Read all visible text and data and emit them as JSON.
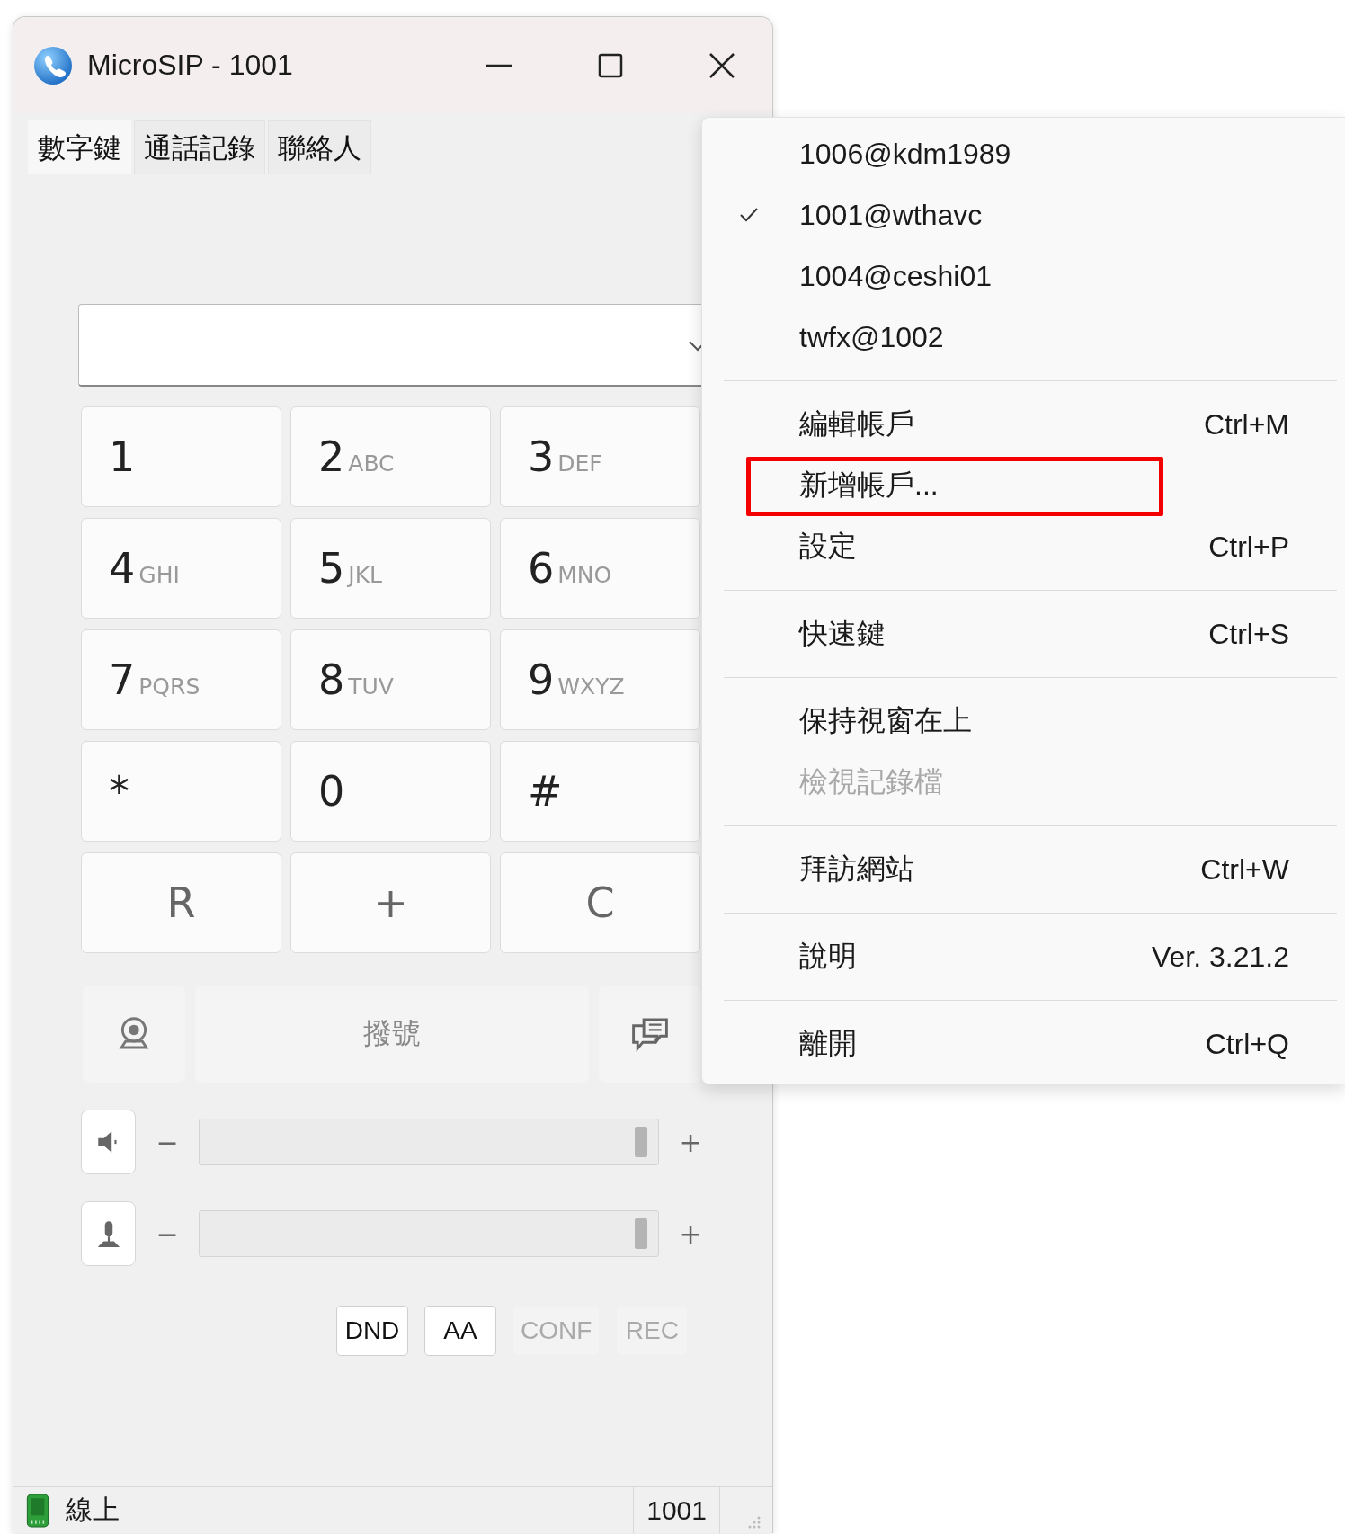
{
  "window": {
    "title": "MicroSIP - 1001"
  },
  "tabs": [
    {
      "label": "數字鍵",
      "selected": true
    },
    {
      "label": "通話記錄",
      "selected": false
    },
    {
      "label": "聯絡人",
      "selected": false
    }
  ],
  "keypad": [
    {
      "kind": "digit",
      "digit": "1"
    },
    {
      "kind": "digit",
      "digit": "2",
      "letters": "ABC"
    },
    {
      "kind": "digit",
      "digit": "3",
      "letters": "DEF"
    },
    {
      "kind": "digit",
      "digit": "4",
      "letters": "GHI"
    },
    {
      "kind": "digit",
      "digit": "5",
      "letters": "JKL"
    },
    {
      "kind": "digit",
      "digit": "6",
      "letters": "MNO"
    },
    {
      "kind": "digit",
      "digit": "7",
      "letters": "PQRS"
    },
    {
      "kind": "digit",
      "digit": "8",
      "letters": "TUV"
    },
    {
      "kind": "digit",
      "digit": "9",
      "letters": "WXYZ"
    },
    {
      "kind": "digit",
      "digit": "*"
    },
    {
      "kind": "digit",
      "digit": "0"
    },
    {
      "kind": "digit",
      "digit": "#"
    },
    {
      "kind": "action",
      "digit": "R"
    },
    {
      "kind": "action",
      "digit": "+"
    },
    {
      "kind": "action",
      "digit": "C"
    }
  ],
  "call_button": {
    "label": "撥號"
  },
  "volume": [
    {
      "kind": "speaker",
      "minus": "−",
      "plus": "+",
      "level": 0.98
    },
    {
      "kind": "microphone",
      "minus": "−",
      "plus": "+",
      "level": 0.98
    }
  ],
  "toggles": [
    {
      "label": "DND",
      "on": true
    },
    {
      "label": "AA",
      "on": true
    },
    {
      "label": "CONF",
      "on": false
    },
    {
      "label": "REC",
      "on": false
    }
  ],
  "status_bar": {
    "status": "線上",
    "account": "1001"
  },
  "menu": {
    "sections": [
      [
        {
          "label": "1006@kdm1989",
          "checked": false,
          "disabled": false,
          "highlighted": false
        },
        {
          "label": "1001@wthavc",
          "checked": true,
          "disabled": false,
          "highlighted": false
        },
        {
          "label": "1004@ceshi01",
          "checked": false,
          "disabled": false,
          "highlighted": false
        },
        {
          "label": "twfx@1002",
          "checked": false,
          "disabled": false,
          "highlighted": false
        }
      ],
      [
        {
          "label": "編輯帳戶",
          "shortcut": "Ctrl+M",
          "checked": false,
          "disabled": false,
          "highlighted": false
        },
        {
          "label": "新增帳戶...",
          "checked": false,
          "disabled": false,
          "highlighted": true
        },
        {
          "label": "設定",
          "shortcut": "Ctrl+P",
          "checked": false,
          "disabled": false,
          "highlighted": false
        }
      ],
      [
        {
          "label": "快速鍵",
          "shortcut": "Ctrl+S",
          "checked": false,
          "disabled": false,
          "highlighted": false
        }
      ],
      [
        {
          "label": "保持視窗在上",
          "checked": false,
          "disabled": false,
          "highlighted": false
        },
        {
          "label": "檢視記錄檔",
          "checked": false,
          "disabled": true,
          "highlighted": false
        }
      ],
      [
        {
          "label": "拜訪網站",
          "shortcut": "Ctrl+W",
          "checked": false,
          "disabled": false,
          "highlighted": false
        }
      ],
      [
        {
          "label": "說明",
          "shortcut": "Ver. 3.21.2",
          "checked": false,
          "disabled": false,
          "highlighted": false
        }
      ],
      [
        {
          "label": "離開",
          "shortcut": "Ctrl+Q",
          "checked": false,
          "disabled": false,
          "highlighted": false
        }
      ]
    ]
  }
}
